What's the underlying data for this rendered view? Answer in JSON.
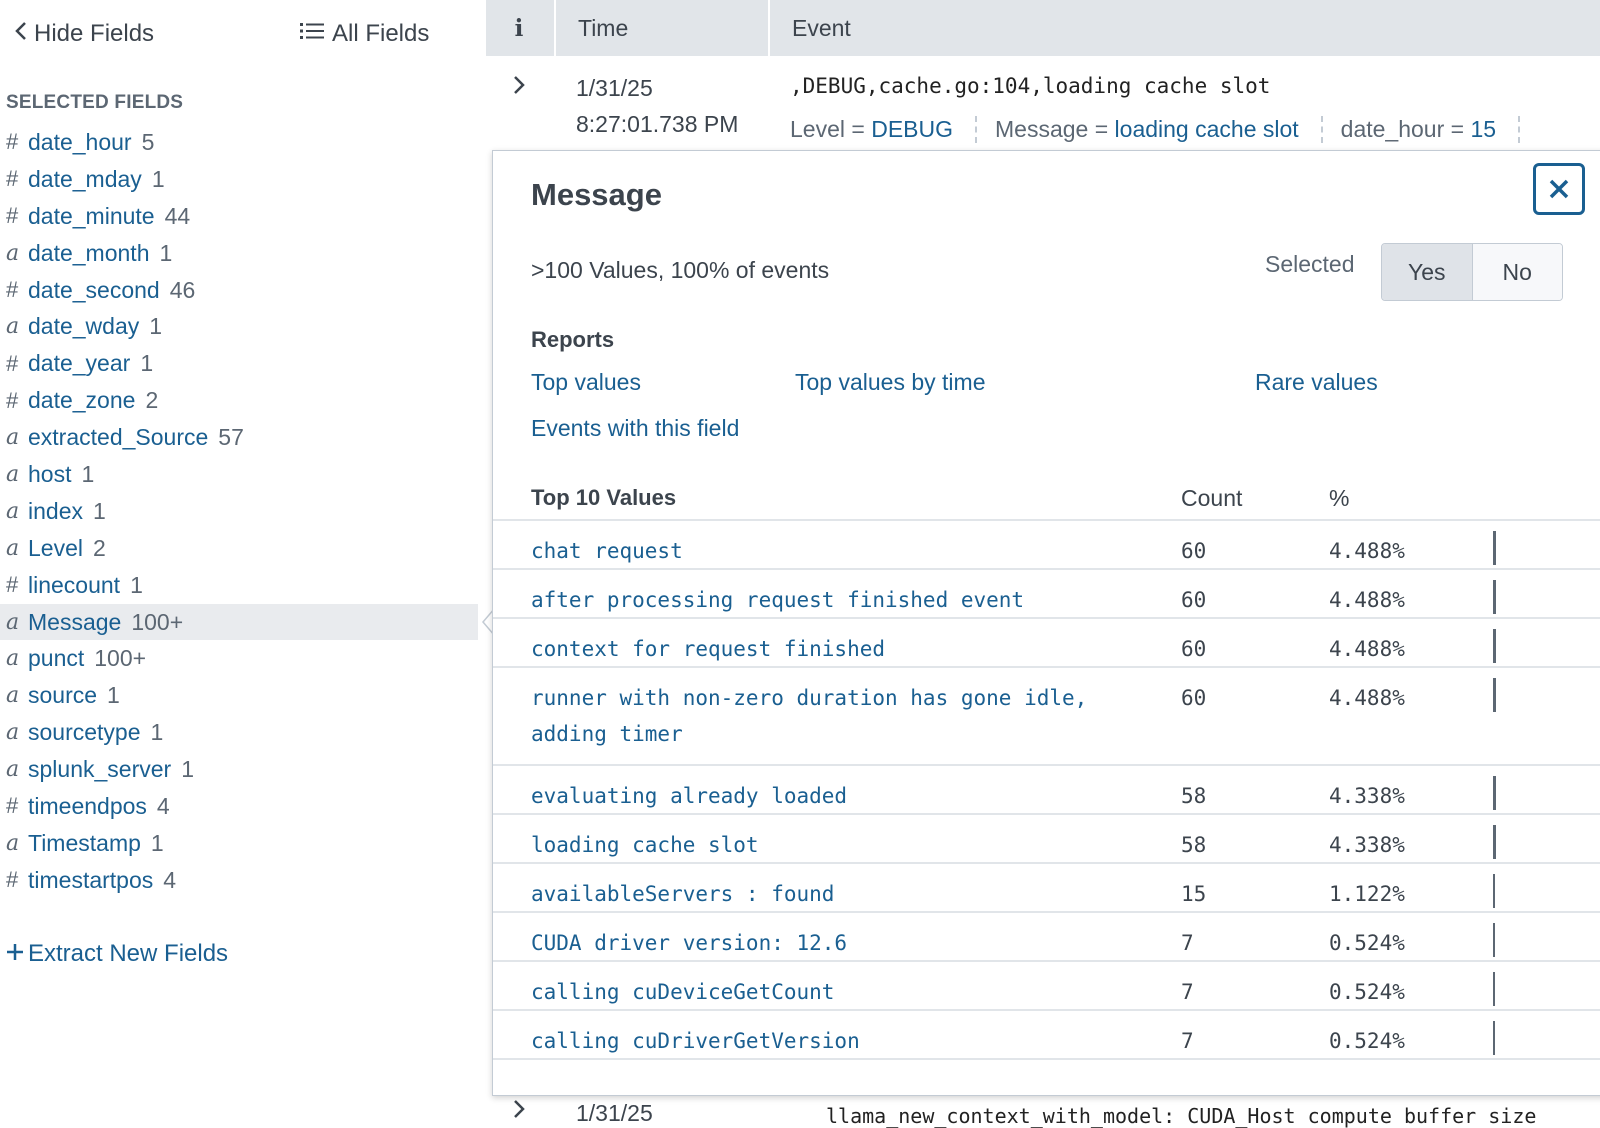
{
  "sidebar": {
    "hide_fields_label": "Hide Fields",
    "all_fields_label": "All Fields",
    "section_title": "SELECTED FIELDS",
    "fields": [
      {
        "type": "#",
        "name": "date_hour",
        "count": "5"
      },
      {
        "type": "#",
        "name": "date_mday",
        "count": "1"
      },
      {
        "type": "#",
        "name": "date_minute",
        "count": "44"
      },
      {
        "type": "a",
        "name": "date_month",
        "count": "1"
      },
      {
        "type": "#",
        "name": "date_second",
        "count": "46"
      },
      {
        "type": "a",
        "name": "date_wday",
        "count": "1"
      },
      {
        "type": "#",
        "name": "date_year",
        "count": "1"
      },
      {
        "type": "#",
        "name": "date_zone",
        "count": "2"
      },
      {
        "type": "a",
        "name": "extracted_Source",
        "count": "57"
      },
      {
        "type": "a",
        "name": "host",
        "count": "1"
      },
      {
        "type": "a",
        "name": "index",
        "count": "1"
      },
      {
        "type": "a",
        "name": "Level",
        "count": "2"
      },
      {
        "type": "#",
        "name": "linecount",
        "count": "1"
      },
      {
        "type": "a",
        "name": "Message",
        "count": "100+",
        "active": true
      },
      {
        "type": "a",
        "name": "punct",
        "count": "100+"
      },
      {
        "type": "a",
        "name": "source",
        "count": "1"
      },
      {
        "type": "a",
        "name": "sourcetype",
        "count": "1"
      },
      {
        "type": "a",
        "name": "splunk_server",
        "count": "1"
      },
      {
        "type": "#",
        "name": "timeendpos",
        "count": "4"
      },
      {
        "type": "a",
        "name": "Timestamp",
        "count": "1"
      },
      {
        "type": "#",
        "name": "timestartpos",
        "count": "4"
      }
    ],
    "extract_label": "Extract New Fields"
  },
  "table": {
    "col_info": "i",
    "col_time": "Time",
    "col_event": "Event",
    "row1": {
      "date": "1/31/25",
      "time": "8:27:01.738 PM",
      "event_text": ",DEBUG,cache.go:104,loading cache slot",
      "fields": [
        {
          "key": "Level =",
          "value": "DEBUG"
        },
        {
          "key": "Message =",
          "value": "loading cache slot"
        },
        {
          "key": "date_hour =",
          "value": "15"
        }
      ]
    },
    "row2": {
      "date": "1/31/25",
      "event_text": "llama_new_context_with_model:  CUDA_Host compute buffer size"
    }
  },
  "popover": {
    "title": "Message",
    "summary": ">100 Values, 100% of events",
    "selected_label": "Selected",
    "yes_label": "Yes",
    "no_label": "No",
    "reports_label": "Reports",
    "reports": {
      "top_values": "Top values",
      "top_values_by_time": "Top values by time",
      "rare_values": "Rare values",
      "events_with_field": "Events with this field"
    },
    "top_header": "Top 10 Values",
    "count_header": "Count",
    "pct_header": "%",
    "values": [
      {
        "name": "chat request",
        "count": "60",
        "pct": "4.488%",
        "share": 4.488
      },
      {
        "name": "after processing request finished event",
        "count": "60",
        "pct": "4.488%",
        "share": 4.488
      },
      {
        "name": "context for request finished",
        "count": "60",
        "pct": "4.488%",
        "share": 4.488
      },
      {
        "name": "runner with non-zero duration has gone idle, adding timer",
        "count": "60",
        "pct": "4.488%",
        "share": 4.488
      },
      {
        "name": "evaluating already loaded",
        "count": "58",
        "pct": "4.338%",
        "share": 4.338
      },
      {
        "name": "loading cache slot",
        "count": "58",
        "pct": "4.338%",
        "share": 4.338
      },
      {
        "name": "availableServers : found",
        "count": "15",
        "pct": "1.122%",
        "share": 1.122
      },
      {
        "name": "CUDA driver version: 12.6",
        "count": "7",
        "pct": "0.524%",
        "share": 0.524
      },
      {
        "name": "calling cuDeviceGetCount",
        "count": "7",
        "pct": "0.524%",
        "share": 0.524
      },
      {
        "name": "calling cuDriverGetVersion",
        "count": "7",
        "pct": "0.524%",
        "share": 0.524
      }
    ]
  }
}
